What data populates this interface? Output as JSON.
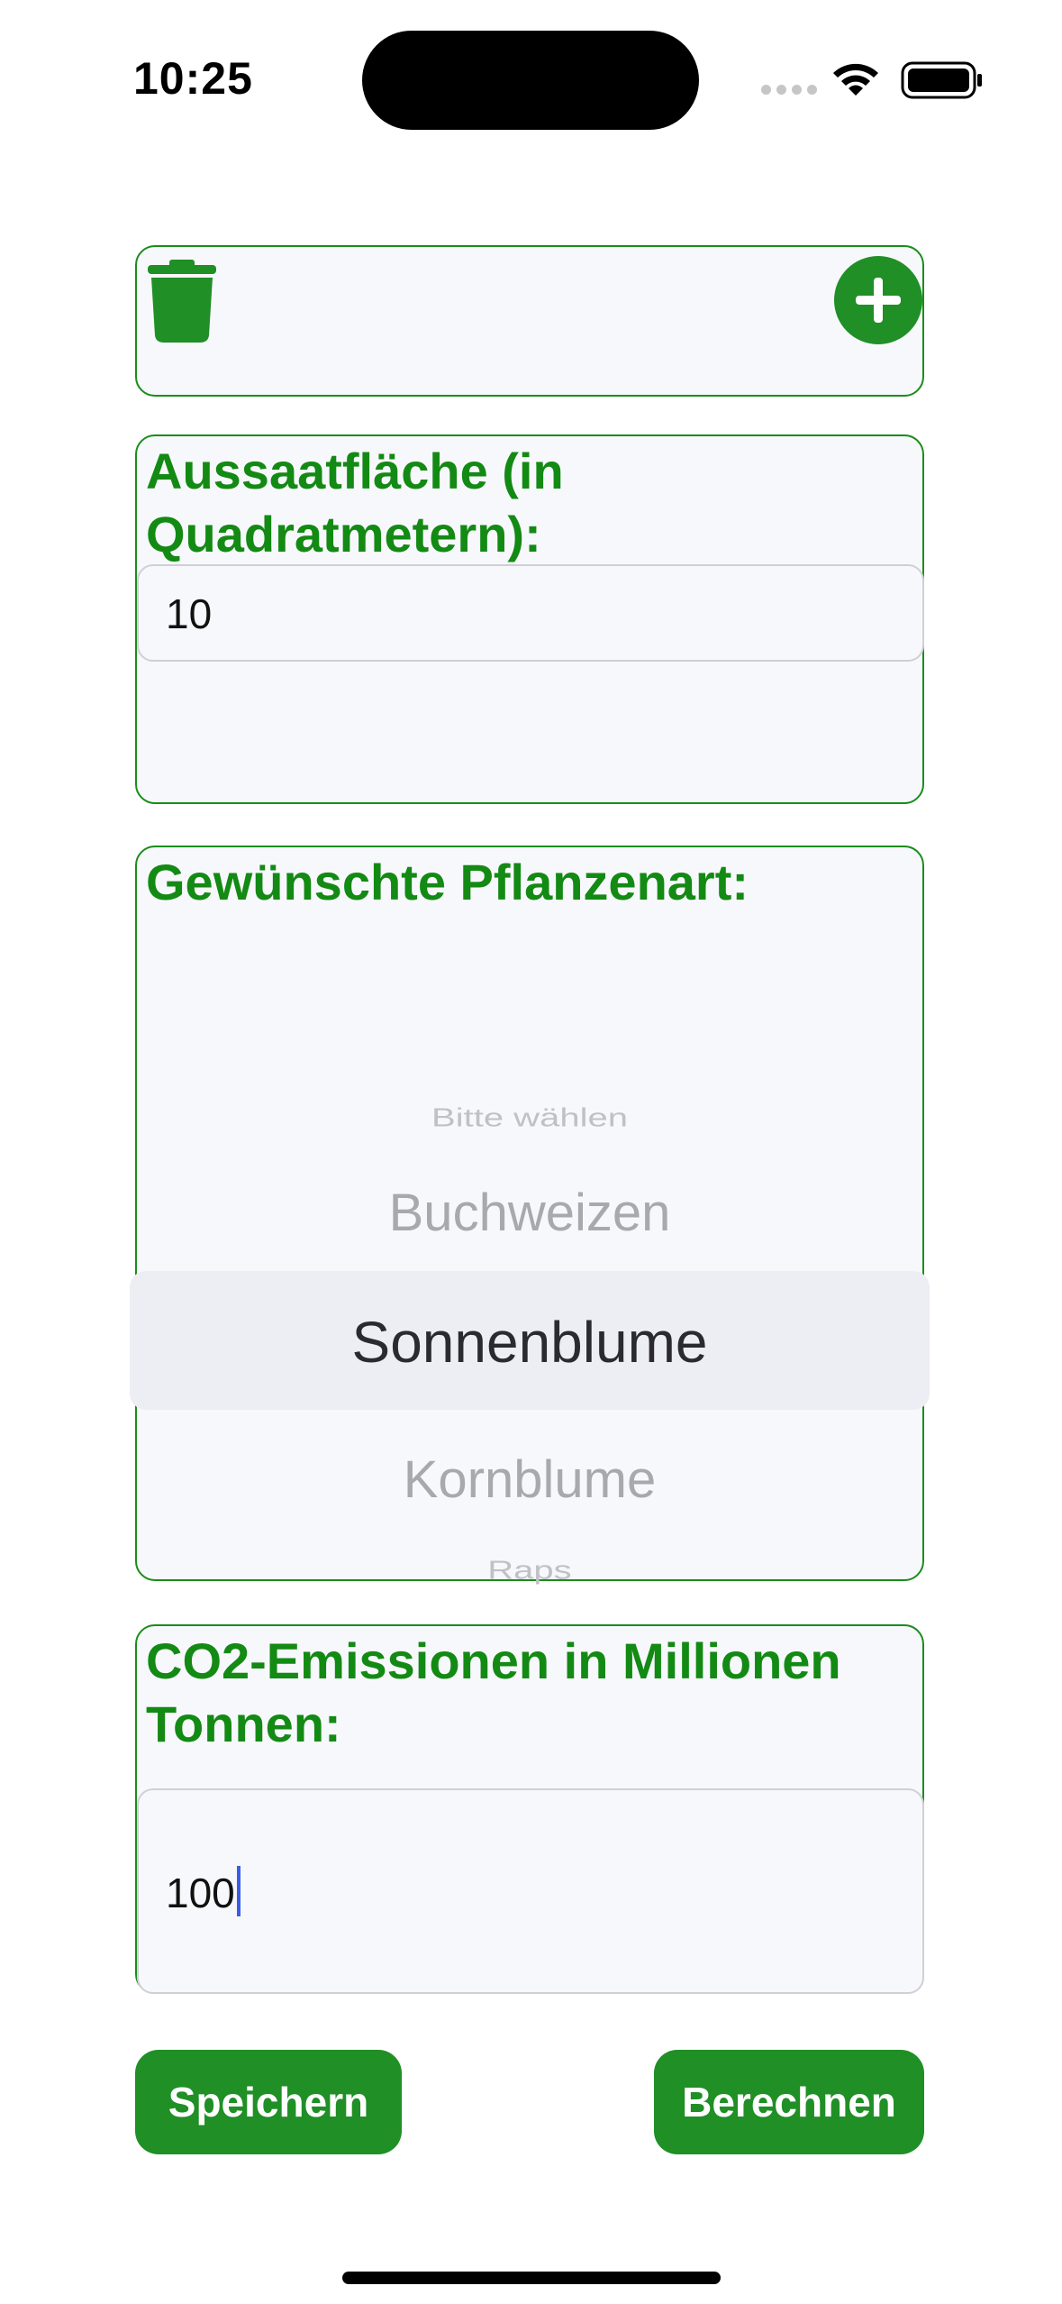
{
  "status_bar": {
    "time": "10:25"
  },
  "toolbar": {
    "delete_icon": "trash-icon",
    "add_icon": "plus-circle-icon"
  },
  "area_card": {
    "label": "Aussaatfläche (in Quadratmetern):",
    "value": "10"
  },
  "plant_card": {
    "label": "Gewünschte Pflanzenart:",
    "options": [
      "Bitte wählen",
      "Buchweizen",
      "Sonnenblume",
      "Kornblume",
      "Raps"
    ],
    "selected": "Sonnenblume"
  },
  "co2_card": {
    "label": "CO2-Emissionen in Millionen Tonnen:",
    "value": "100"
  },
  "buttons": {
    "save": "Speichern",
    "calculate": "Berechnen"
  },
  "colors": {
    "accent": "#1f8f26",
    "text_accent": "#138a13",
    "card_bg": "#f7f8fc",
    "caret": "#3a5de8"
  }
}
